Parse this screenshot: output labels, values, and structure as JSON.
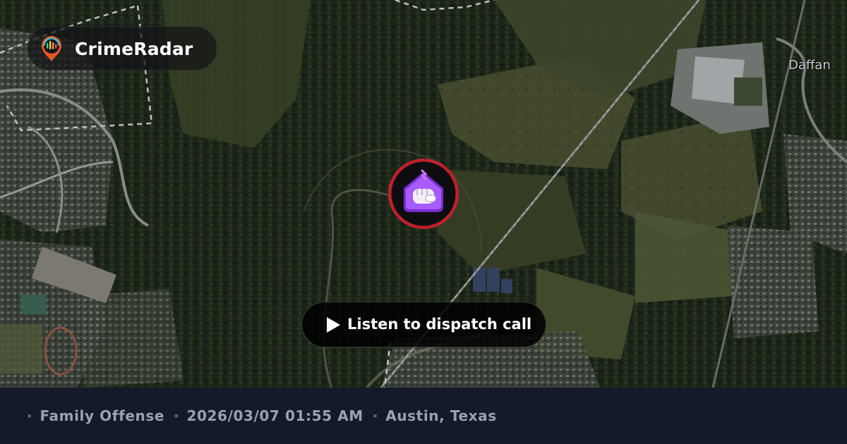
{
  "brand": {
    "name": "CrimeRadar",
    "logo_icon": "radar-pin-icon"
  },
  "map": {
    "place_label": "Daffan",
    "marker_icon": "family-offense-fist-house-icon",
    "marker_ring_color": "#c0202a"
  },
  "cta": {
    "label": "Listen to dispatch call",
    "icon": "play-icon"
  },
  "incident": {
    "type": "Family Offense",
    "datetime": "2026/03/07 01:55 AM",
    "location": "Austin, Texas",
    "separator": "•"
  },
  "colors": {
    "footer_bg": "#141a2a",
    "footer_text": "#9aa1b2",
    "marker_purple": "#9b4dff"
  }
}
